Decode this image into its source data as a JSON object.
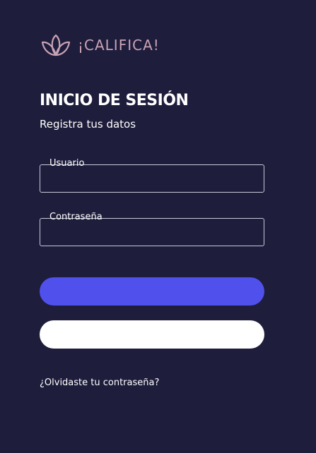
{
  "brand": {
    "name": "¡CALIFICA!",
    "logo_icon": "lotus-icon",
    "color": "#c9a3b5"
  },
  "login": {
    "title": "INICIO DE SESIÓN",
    "subtitle": "Registra tus datos",
    "username_label": "Usuario",
    "username_value": "",
    "password_label": "Contraseña",
    "password_value": "",
    "primary_button_label": "",
    "secondary_button_label": "",
    "forgot_password_link": "¿Olvidaste tu contraseña?"
  },
  "colors": {
    "background": "#1e1d3c",
    "primary_button": "#5050ec",
    "secondary_button": "#ffffff",
    "input_border": "#c9c9d8"
  }
}
